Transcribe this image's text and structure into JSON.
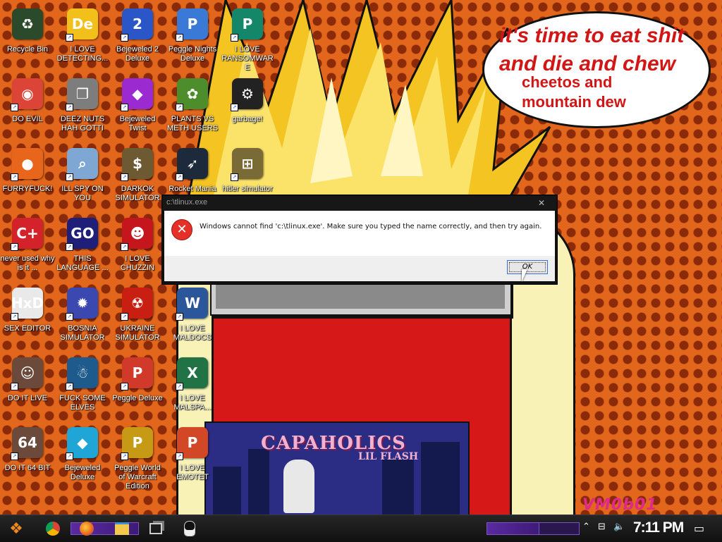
{
  "desktop": {
    "icons": [
      {
        "label": "Recycle Bin",
        "icon": "recycle-bin-icon",
        "color": "#2b4a2b",
        "glyph": "♻"
      },
      {
        "label": "I LOVE DETECTING...",
        "icon": "detect-it-easy-icon",
        "color": "#f2c01a",
        "glyph": "De"
      },
      {
        "label": "Bejeweled 2 Deluxe",
        "icon": "bejeweled-2-icon",
        "color": "#2a56c8",
        "glyph": "2"
      },
      {
        "label": "Peggle Nights Deluxe",
        "icon": "peggle-nights-icon",
        "color": "#3b79d6",
        "glyph": "P"
      },
      {
        "label": "I LOVE RANSOMWARE",
        "icon": "publisher-icon",
        "color": "#14866a",
        "glyph": "P"
      },
      {
        "label": "DO EVIL",
        "icon": "chrome-icon",
        "color": "#db4437",
        "glyph": "◉"
      },
      {
        "label": "DEEZ NUTS HAH GOTTI",
        "icon": "windows-stack-icon",
        "color": "#7d7d7d",
        "glyph": "❐"
      },
      {
        "label": "Bejeweled Twist",
        "icon": "bejeweled-twist-icon",
        "color": "#9b2ad1",
        "glyph": "◆"
      },
      {
        "label": "PLANTS VS METH USERS",
        "icon": "plants-vs-zombies-icon",
        "color": "#4d8d2b",
        "glyph": "✿"
      },
      {
        "label": "garbage!",
        "icon": "garbage-app-icon",
        "color": "#222222",
        "glyph": "⚙"
      },
      {
        "label": "FURRYFUCK!",
        "icon": "firefox-icon",
        "color": "#e8661c",
        "glyph": "●"
      },
      {
        "label": "ILL SPY ON YOU",
        "icon": "spy-magnifier-icon",
        "color": "#7fa7d4",
        "glyph": "⌕"
      },
      {
        "label": "DARKOK SIMULATOR",
        "icon": "money-bag-icon",
        "color": "#6d5a33",
        "glyph": "$"
      },
      {
        "label": "Rocket Mania",
        "icon": "rocket-mania-icon",
        "color": "#1c2a3c",
        "glyph": "➶"
      },
      {
        "label": "hitler simulator",
        "icon": "coin-emblem-icon",
        "color": "#7a6a35",
        "glyph": "⊞"
      },
      {
        "label": "never used why is it ...",
        "icon": "dev-cpp-icon",
        "color": "#d3222a",
        "glyph": "C+"
      },
      {
        "label": "THIS LANGUAGE ...",
        "icon": "goland-icon",
        "color": "#1f1f7a",
        "glyph": "GO"
      },
      {
        "label": "I LOVE CHUZZIN",
        "icon": "chuzzle-icon",
        "color": "#c4161c",
        "glyph": "☻"
      },
      {
        "label": "SEX EDITOR",
        "icon": "hxd-editor-icon",
        "color": "#e9e9e9",
        "glyph": "HxD"
      },
      {
        "label": "BOSNIA SIMULATOR",
        "icon": "mine-icon",
        "color": "#3a48b0",
        "glyph": "✹"
      },
      {
        "label": "UKRAINE SIMULATOR",
        "icon": "radiation-icon",
        "color": "#c81f12",
        "glyph": "☢"
      },
      {
        "label": "I LOVE MALDOCS",
        "icon": "word-icon",
        "color": "#2b579a",
        "glyph": "W"
      },
      {
        "label": "DO IT LIVE",
        "icon": "portrait-icon",
        "color": "#6b4a3b",
        "glyph": "☺"
      },
      {
        "label": "FUCK SOME ELVES",
        "icon": "santa-icon",
        "color": "#1e5b8c",
        "glyph": "☃"
      },
      {
        "label": "Peggle Deluxe",
        "icon": "peggle-icon",
        "color": "#d13a2a",
        "glyph": "P"
      },
      {
        "label": "I LOVE MALSPA...",
        "icon": "excel-icon",
        "color": "#217346",
        "glyph": "X"
      },
      {
        "label": "DO IT 64 BIT",
        "icon": "portrait-64-icon",
        "color": "#6b4a3b",
        "glyph": "64"
      },
      {
        "label": "Bejeweled Deluxe",
        "icon": "bejeweled-diamond-icon",
        "color": "#1fa6d6",
        "glyph": "◆"
      },
      {
        "label": "Peggle World of Warcraft Edition",
        "icon": "peggle-wow-icon",
        "color": "#c79a16",
        "glyph": "P"
      },
      {
        "label": "I LOVE EMOTET",
        "icon": "powerpoint-icon",
        "color": "#d24726",
        "glyph": "P"
      }
    ]
  },
  "wallpaper": {
    "bubble_line1": "it's time to eat shit",
    "bubble_line2": "and die and chew",
    "bubble_line3": "cheetos and",
    "bubble_line4": "mountain dew",
    "album_title": "CAPAHOLICS",
    "album_subtitle": "LIL FLASH",
    "signature": "VM0b01"
  },
  "dialog": {
    "title": "c:\\tlinux.exe",
    "close_glyph": "✕",
    "error_glyph": "✕",
    "message": "Windows cannot find 'c:\\tlinux.exe'. Make sure you typed the name correctly, and then try again.",
    "ok_label": "OK"
  },
  "taskbar": {
    "start_glyph": "❖",
    "clock": "7:11 PM",
    "notification_glyph": "▭",
    "tray_up_glyph": "⌃",
    "network_glyph": "⊟",
    "volume_glyph": "🔈"
  },
  "colors": {
    "wallpaper_bg": "#e2661b",
    "taskbar": "#151515",
    "accent_purple": "#5a2aa0",
    "bubble_text": "#d21616",
    "error_red": "#e5302a"
  }
}
